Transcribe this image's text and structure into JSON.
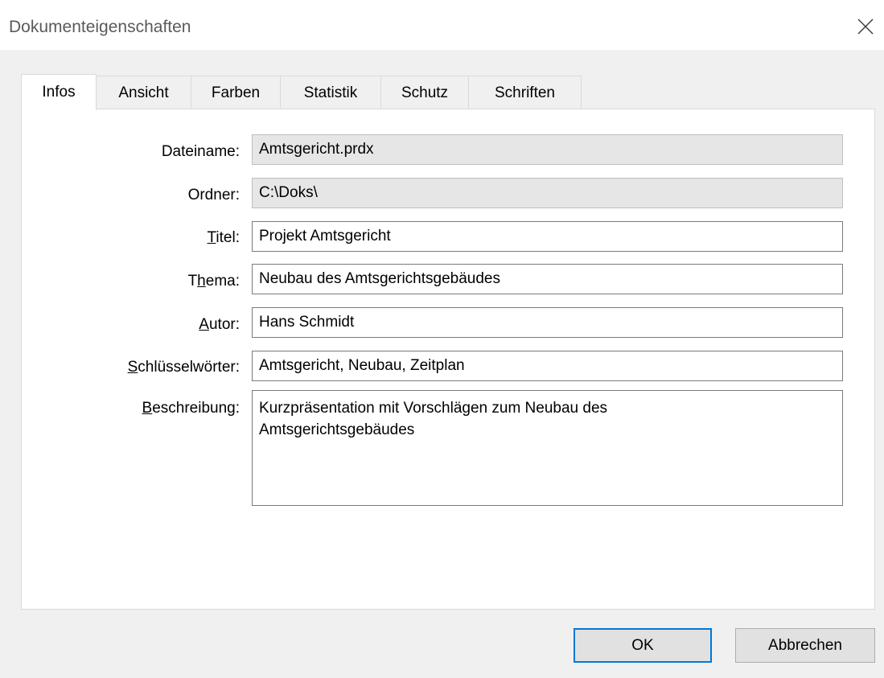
{
  "window": {
    "title": "Dokumenteigenschaften"
  },
  "tabs": [
    {
      "label": "Infos",
      "active": true
    },
    {
      "label": "Ansicht",
      "active": false
    },
    {
      "label": "Farben",
      "active": false
    },
    {
      "label": "Statistik",
      "active": false
    },
    {
      "label": "Schutz",
      "active": false
    },
    {
      "label": "Schriften",
      "active": false
    }
  ],
  "fields": {
    "dateiname": {
      "label": "Dateiname:",
      "value": "Amtsgericht.prdx"
    },
    "ordner": {
      "label": "Ordner:",
      "value": "C:\\Doks\\"
    },
    "titel": {
      "label_accel": "T",
      "label_rest": "itel:",
      "value": "Projekt Amtsgericht"
    },
    "thema": {
      "label_pre": "T",
      "label_accel": "h",
      "label_rest": "ema:",
      "value": "Neubau des Amtsgerichtsgebäudes"
    },
    "autor": {
      "label_accel": "A",
      "label_rest": "utor:",
      "value": "Hans Schmidt"
    },
    "schluesselwoerter": {
      "label_accel": "S",
      "label_rest": "chlüsselwörter:",
      "value": "Amtsgericht, Neubau, Zeitplan"
    },
    "beschreibung": {
      "label_accel": "B",
      "label_rest": "eschreibung:",
      "value": "Kurzpräsentation mit Vorschlägen zum Neubau des Amtsgerichtsgebäudes"
    }
  },
  "buttons": {
    "ok": "OK",
    "cancel": "Abbrechen"
  },
  "icons": {
    "close": "close-icon"
  }
}
